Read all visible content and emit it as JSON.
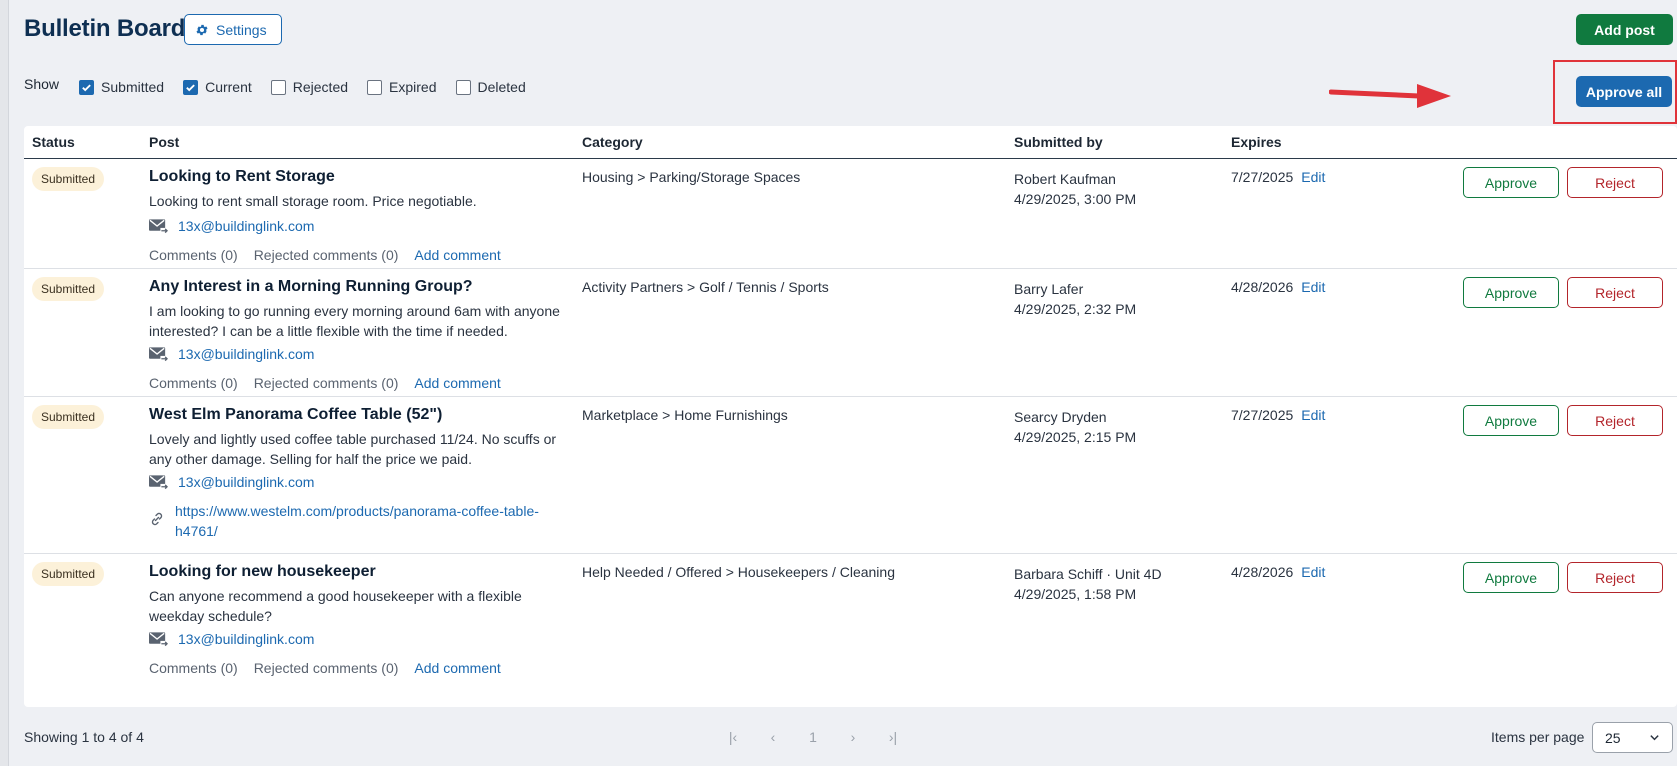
{
  "header": {
    "title": "Bulletin Board",
    "settings_label": "Settings",
    "add_post_label": "Add post"
  },
  "filters": {
    "show_label": "Show",
    "options": [
      {
        "label": "Submitted",
        "checked": true
      },
      {
        "label": "Current",
        "checked": true
      },
      {
        "label": "Rejected",
        "checked": false
      },
      {
        "label": "Expired",
        "checked": false
      },
      {
        "label": "Deleted",
        "checked": false
      }
    ]
  },
  "approve_all_label": "Approve all",
  "table": {
    "headers": {
      "status": "Status",
      "post": "Post",
      "category": "Category",
      "submitted_by": "Submitted by",
      "expires": "Expires"
    },
    "rows": [
      {
        "status": "Submitted",
        "title": "Looking to Rent Storage",
        "body": "Looking to rent small storage room. Price negotiable.",
        "email": "13x@buildinglink.com",
        "comments": "Comments (0)",
        "rejected_comments": "Rejected comments (0)",
        "add_comment": "Add comment",
        "category": "Housing > Parking/Storage Spaces",
        "submitter": "Robert Kaufman",
        "submitted_at": "4/29/2025, 3:00 PM",
        "expires": "7/27/2025",
        "edit": "Edit",
        "approve": "Approve",
        "reject": "Reject"
      },
      {
        "status": "Submitted",
        "title": "Any Interest in a Morning Running Group?",
        "body": "I am looking to go running every morning around 6am with anyone interested? I can be a little flexible with the time if needed.",
        "email": "13x@buildinglink.com",
        "comments": "Comments (0)",
        "rejected_comments": "Rejected comments (0)",
        "add_comment": "Add comment",
        "category": "Activity Partners > Golf / Tennis / Sports",
        "submitter": "Barry Lafer",
        "submitted_at": "4/29/2025, 2:32 PM",
        "expires": "4/28/2026",
        "edit": "Edit",
        "approve": "Approve",
        "reject": "Reject"
      },
      {
        "status": "Submitted",
        "title": "West Elm Panorama Coffee Table (52\")",
        "body": "Lovely and lightly used coffee table purchased 11/24. No scuffs or any other damage. Selling for half the price we paid.",
        "email": "13x@buildinglink.com",
        "link": "https://www.westelm.com/products/panorama-coffee-table-h4761/",
        "category": "Marketplace > Home Furnishings",
        "submitter": "Searcy Dryden",
        "submitted_at": "4/29/2025, 2:15 PM",
        "expires": "7/27/2025",
        "edit": "Edit",
        "approve": "Approve",
        "reject": "Reject"
      },
      {
        "status": "Submitted",
        "title": "Looking for new housekeeper",
        "body": "Can anyone recommend a good housekeeper with a flexible weekday schedule?",
        "email": "13x@buildinglink.com",
        "comments": "Comments (0)",
        "rejected_comments": "Rejected comments (0)",
        "add_comment": "Add comment",
        "category": "Help Needed / Offered > Housekeepers / Cleaning",
        "submitter": "Barbara Schiff · Unit 4D",
        "submitted_at": "4/29/2025, 1:58 PM",
        "expires": "4/28/2026",
        "edit": "Edit",
        "approve": "Approve",
        "reject": "Reject"
      }
    ]
  },
  "footer": {
    "showing": "Showing 1 to 4 of 4",
    "pager": {
      "first": "|‹",
      "prev": "‹",
      "page": "1",
      "next": "›",
      "last": "›|"
    },
    "items_per_page_label": "Items per page",
    "items_per_page_value": "25"
  },
  "colors": {
    "primary": "#1c69b0",
    "success": "#107a3f",
    "danger": "#b3252b",
    "annotation": "#e0333a"
  }
}
